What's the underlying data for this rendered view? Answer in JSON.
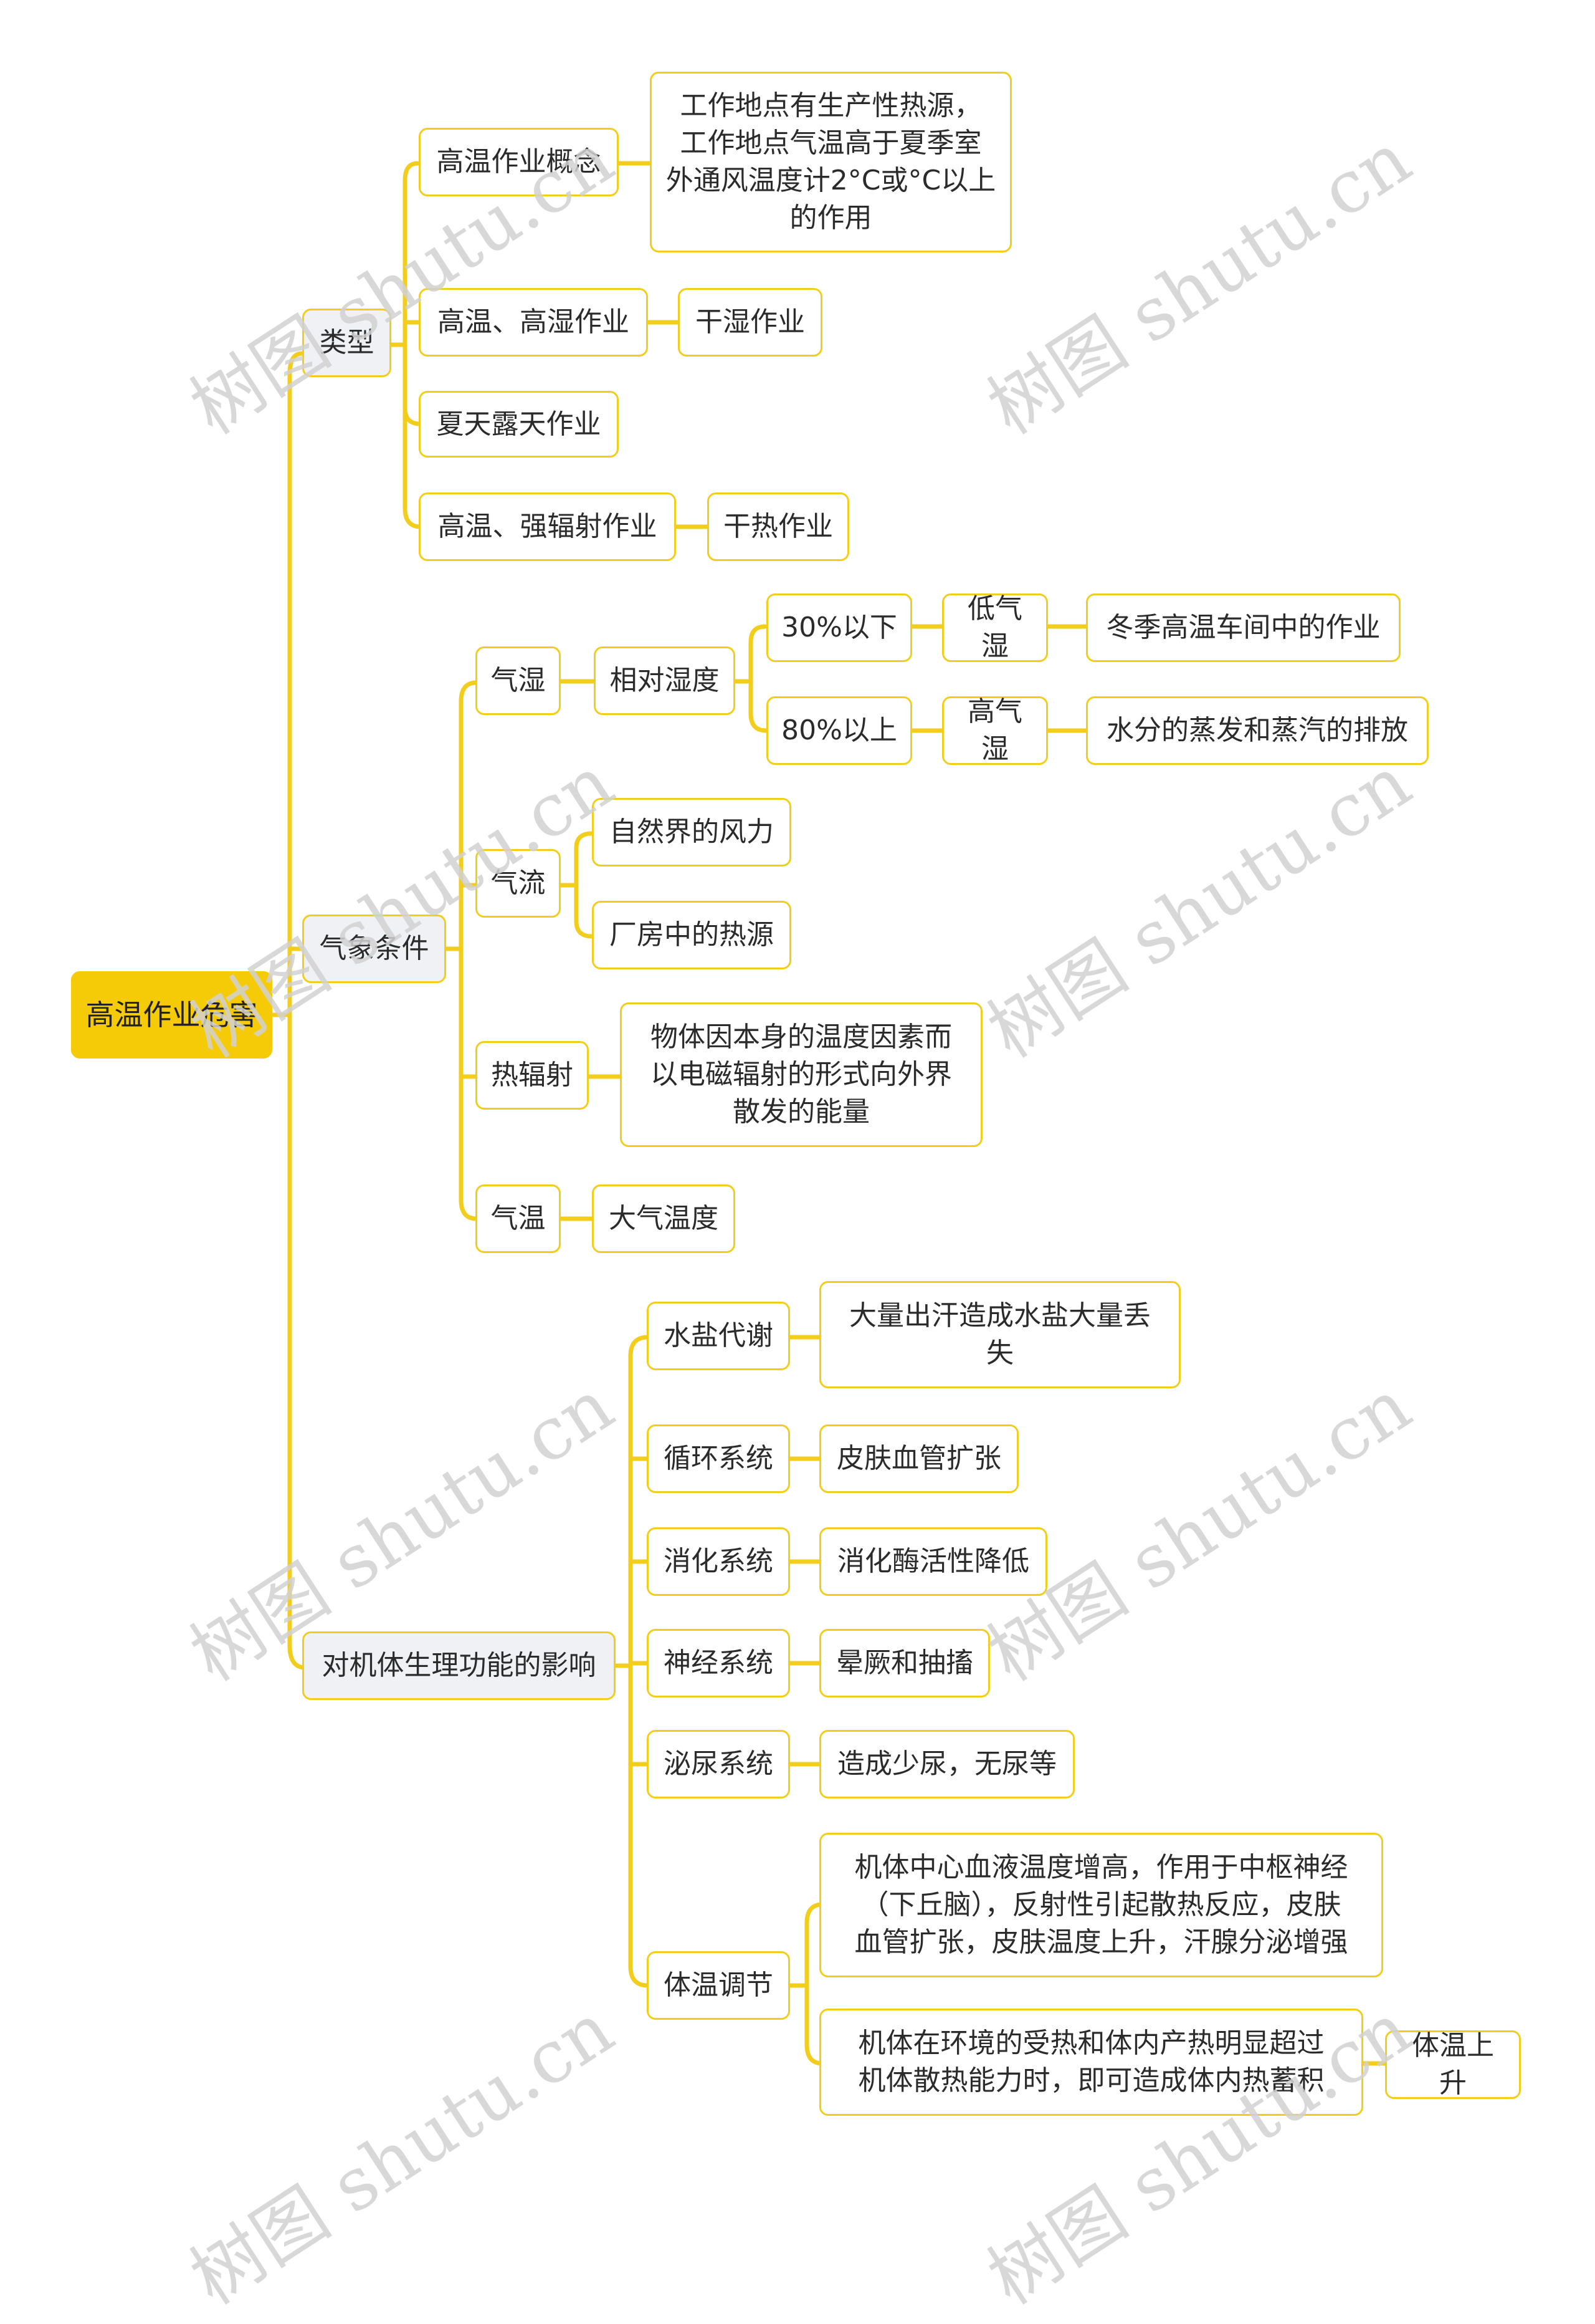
{
  "root": "高温作业危害",
  "branches": {
    "types": {
      "label": "类型",
      "items": {
        "concept": {
          "label": "高温作业概念",
          "detail": "工作地点有生产性热源，\n工作地点气温高于夏季室\n外通风温度计2°C或°C以上\n的作用"
        },
        "humid": {
          "label": "高温、高湿作业",
          "detail": "干湿作业"
        },
        "outdoor": {
          "label": "夏天露天作业"
        },
        "radiation": {
          "label": "高温、强辐射作业",
          "detail": "干热作业"
        }
      }
    },
    "weather": {
      "label": "气象条件",
      "humidity": {
        "label": "气湿",
        "relative": "相对湿度",
        "low": {
          "range": "30%以下",
          "type": "低气湿",
          "desc": "冬季高温车间中的作业"
        },
        "high": {
          "range": "80%以上",
          "type": "高气湿",
          "desc": "水分的蒸发和蒸汽的排放"
        }
      },
      "airflow": {
        "label": "气流",
        "items": [
          "自然界的风力",
          "厂房中的热源"
        ]
      },
      "heat_radiation": {
        "label": "热辐射",
        "desc": "物体因本身的温度因素而\n以电磁辐射的形式向外界\n散发的能量"
      },
      "temperature": {
        "label": "气温",
        "desc": "大气温度"
      }
    },
    "physiology": {
      "label": "对机体生理功能的影响",
      "items": {
        "water_salt": {
          "label": "水盐代谢",
          "desc": "大量出汗造成水盐大量丢\n失"
        },
        "circulatory": {
          "label": "循环系统",
          "desc": "皮肤血管扩张"
        },
        "digestive": {
          "label": "消化系统",
          "desc": "消化酶活性降低"
        },
        "nervous": {
          "label": "神经系统",
          "desc": "晕厥和抽搐"
        },
        "urinary": {
          "label": "泌尿系统",
          "desc": "造成少尿，无尿等"
        },
        "thermoregulation": {
          "label": "体温调节",
          "desc1": "机体中心血液温度增高，作用于中枢神经\n（下丘脑），反射性引起散热反应，皮肤\n血管扩张，皮肤温度上升，汗腺分泌增强",
          "desc2": "机体在环境的受热和体内产热明显超过\n机体散热能力时，即可造成体内热蓄积",
          "result": "体温上升"
        }
      }
    }
  },
  "watermark": "树图 shutu.cn",
  "colors": {
    "accent": "#f5cb08",
    "line": "#f2cd1c",
    "category_bg": "#eff1f4",
    "text": "#2b2b2b"
  }
}
